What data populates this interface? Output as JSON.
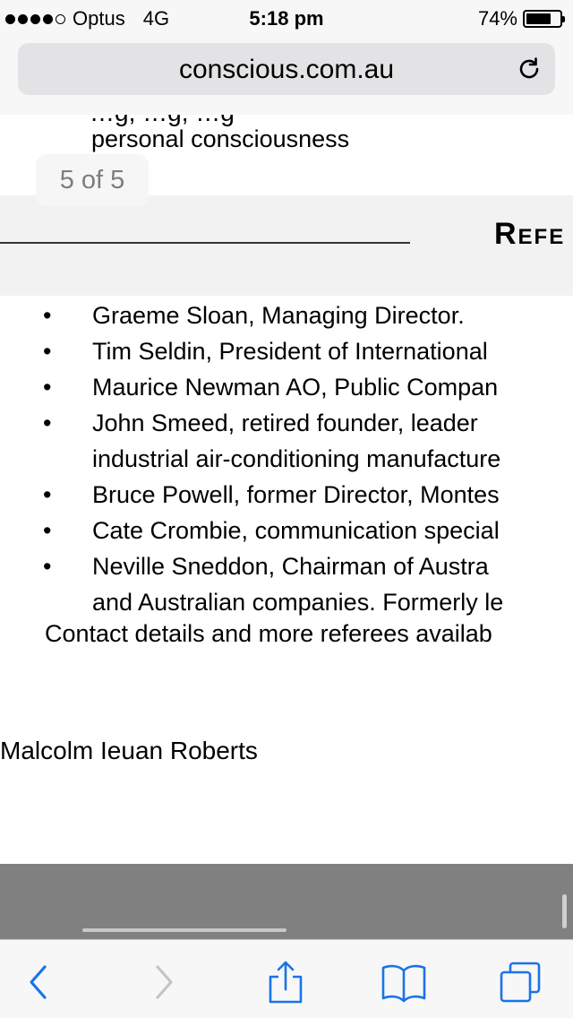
{
  "status_bar": {
    "carrier": "Optus",
    "network": "4G",
    "time": "5:18 pm",
    "battery_percent": "74%",
    "battery_level": 0.74
  },
  "browser": {
    "url": "conscious.com.au"
  },
  "page": {
    "cut_off_text": "…g, …g, …g",
    "previous_line": "personal consciousness",
    "find_result": "5 of 5",
    "section_heading": "Refe",
    "referees": [
      {
        "lines": [
          "Graeme Sloan, Managing Director."
        ]
      },
      {
        "lines": [
          "Tim Seldin, President of International"
        ]
      },
      {
        "lines": [
          "Maurice Newman AO, Public Compan"
        ]
      },
      {
        "lines": [
          "John Smeed, retired founder, leader",
          "industrial air-conditioning manufacture"
        ]
      },
      {
        "lines": [
          "Bruce Powell, former Director, Montes"
        ]
      },
      {
        "lines": [
          "Cate Crombie, communication special"
        ]
      },
      {
        "lines": [
          "Neville Sneddon, Chairman of Austra",
          "and Australian companies. Formerly le"
        ]
      }
    ],
    "bullet": "•",
    "contact_line": "Contact details and more referees availab",
    "signature": "Malcolm Ieuan Roberts"
  },
  "colors": {
    "toolbar_blue": "#1a73e8",
    "disabled_gray": "#c4c4c4",
    "footer_gray": "#808080"
  },
  "toolbar": {
    "back_icon": "chevron-left-icon",
    "forward_icon": "chevron-right-icon",
    "share_icon": "share-icon",
    "bookmarks_icon": "book-icon",
    "tabs_icon": "tabs-icon"
  }
}
